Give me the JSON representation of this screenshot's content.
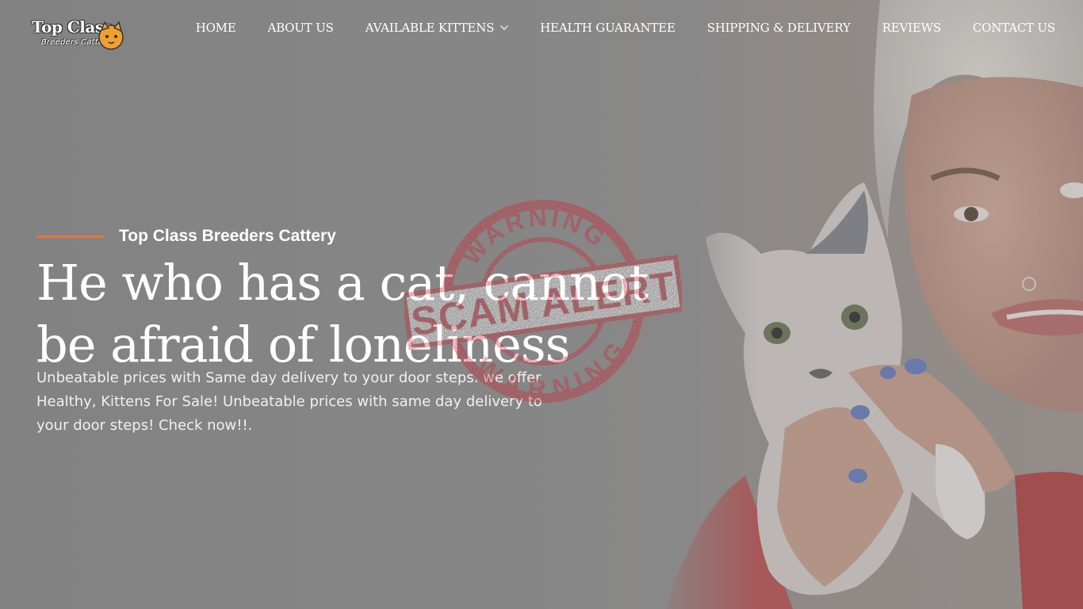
{
  "brand": {
    "logo_line1": "Top Class",
    "logo_line2": "Breeders Cattery"
  },
  "nav": {
    "items": [
      {
        "label": "HOME"
      },
      {
        "label": "ABOUT US"
      },
      {
        "label": "AVAILABLE KITTENS",
        "has_dropdown": true
      },
      {
        "label": "HEALTH GUARANTEE"
      },
      {
        "label": "SHIPPING & DELIVERY"
      },
      {
        "label": "REVIEWS"
      },
      {
        "label": "CONTACT US"
      }
    ]
  },
  "hero": {
    "subtitle": "Top Class Breeders Cattery",
    "headline": "He who has a cat, cannot be afraid of loneliness",
    "description": "Unbeatable prices with Same day delivery to your door steps. we offer Healthy, Kittens For Sale! Unbeatable prices with same day delivery to your door steps! Check now!!.",
    "accent_color": "#e8743c"
  },
  "stamp": {
    "top_text": "WARNING",
    "center_text": "SCAM ALERT",
    "bottom_text": "WARNING",
    "color": "#d0202e"
  }
}
